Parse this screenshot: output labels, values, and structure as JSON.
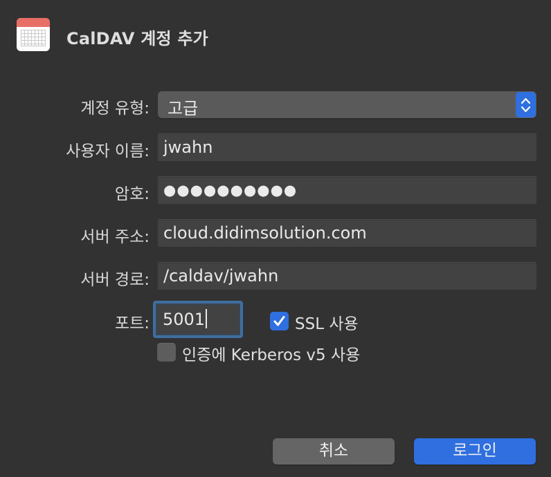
{
  "header": {
    "title": "CalDAV 계정 추가"
  },
  "form": {
    "account_type_label": "계정 유형:",
    "account_type_value": "고급",
    "username_label": "사용자 이름:",
    "username_value": "jwahn",
    "password_label": "암호:",
    "password_value": "●●●●●●●●●●",
    "server_address_label": "서버 주소:",
    "server_address_value": "cloud.didimsolution.com",
    "server_path_label": "서버 경로:",
    "server_path_value": "/caldav/jwahn",
    "port_label": "포트:",
    "port_value": "5001",
    "ssl_label": "SSL 사용",
    "ssl_checked": true,
    "kerberos_label": "인증에 Kerberos v5 사용",
    "kerberos_checked": false
  },
  "buttons": {
    "cancel_label": "취소",
    "login_label": "로그인"
  },
  "colors": {
    "accent": "#2f6fe0",
    "background": "#323232",
    "field": "#424242"
  },
  "icons": {
    "app": "calendar-icon",
    "stepper": "up-down-chevron-icon",
    "check": "checkmark-icon"
  }
}
